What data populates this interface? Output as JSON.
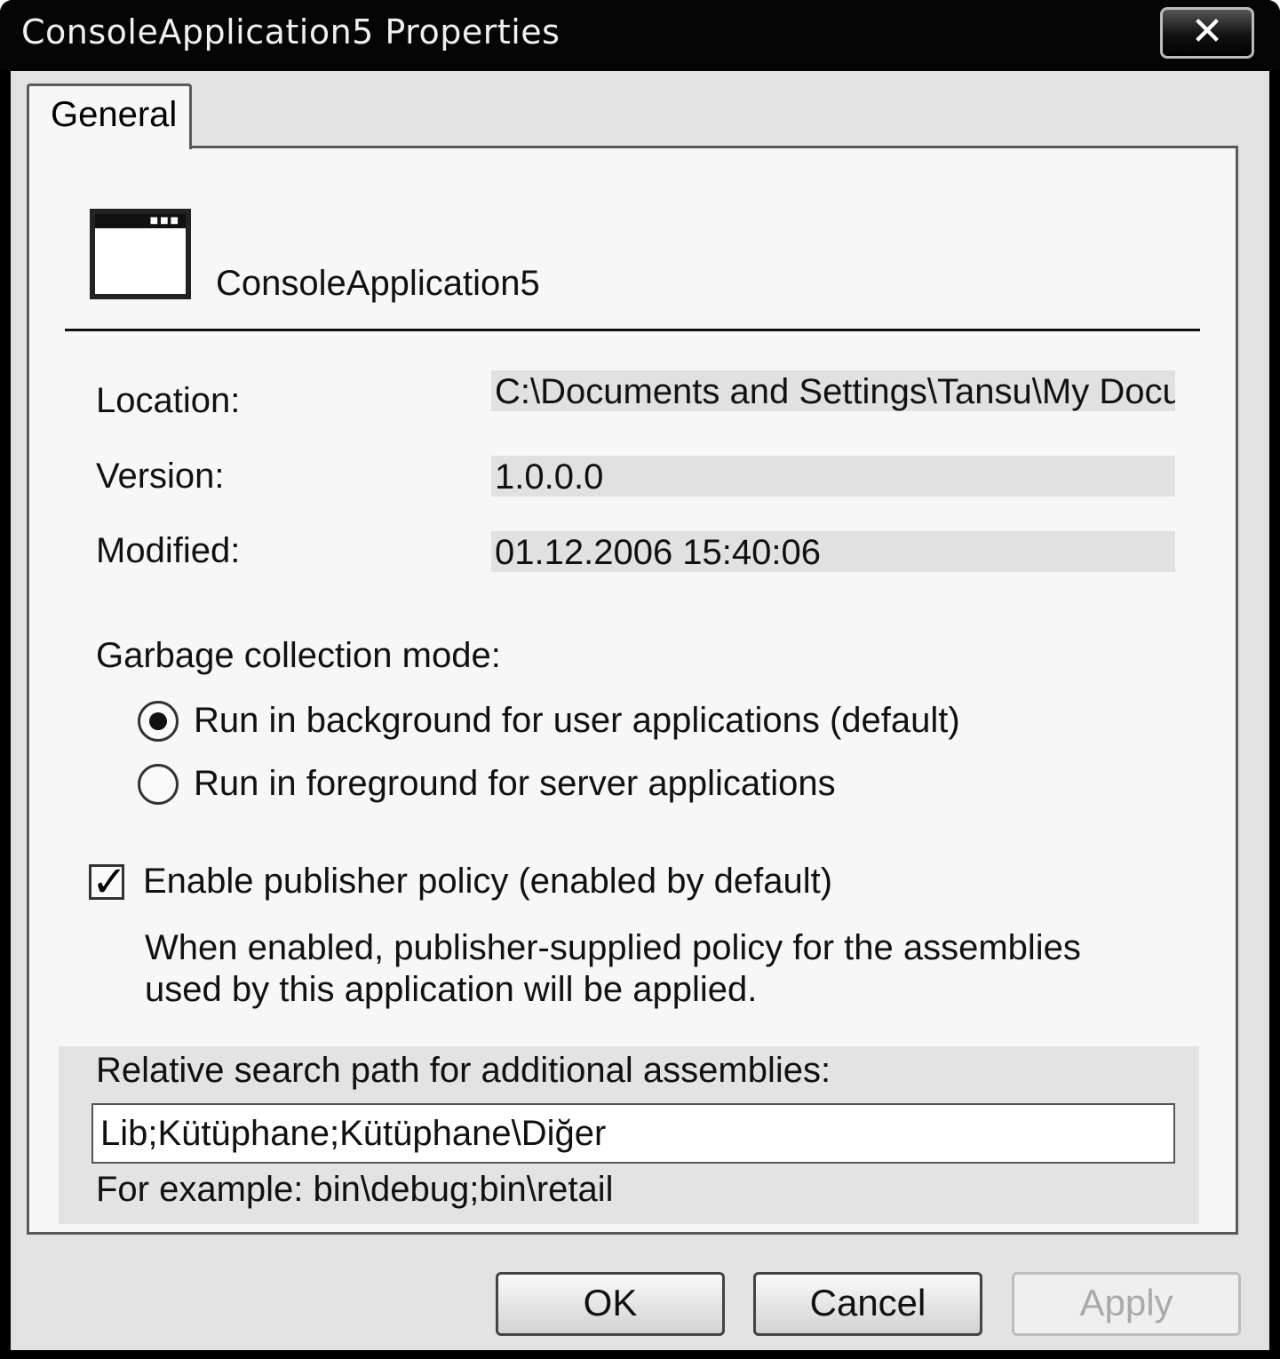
{
  "window": {
    "title": "ConsoleApplication5 Properties",
    "close_glyph": "✕"
  },
  "tabs": [
    {
      "label": "General",
      "selected": true
    }
  ],
  "general": {
    "app_icon": "console-window-icon",
    "app_name": "ConsoleApplication5",
    "location_label": "Location:",
    "location_value": "C:\\Documents and Settings\\Tansu\\My Docu",
    "version_label": "Version:",
    "version_value": "1.0.0.0",
    "modified_label": "Modified:",
    "modified_value": "01.12.2006 15:40:06",
    "gc_mode_label": "Garbage collection mode:",
    "gc_options": [
      {
        "label": "Run in background for user applications (default)",
        "checked": true
      },
      {
        "label": "Run in foreground for server applications",
        "checked": false
      }
    ],
    "publisher_policy_label": "Enable publisher policy (enabled by default)",
    "publisher_policy_checked": true,
    "publisher_policy_desc_line1": "When enabled, publisher-supplied policy for the assemblies",
    "publisher_policy_desc_line2": "used by this application will be applied.",
    "search_path_label": "Relative search path for additional assemblies:",
    "search_path_value": "Lib;Kütüphane;Kütüphane\\Diğer",
    "search_path_example": "For example: bin\\debug;bin\\retail"
  },
  "buttons": {
    "ok": "OK",
    "cancel": "Cancel",
    "apply": "Apply",
    "apply_enabled": false
  }
}
